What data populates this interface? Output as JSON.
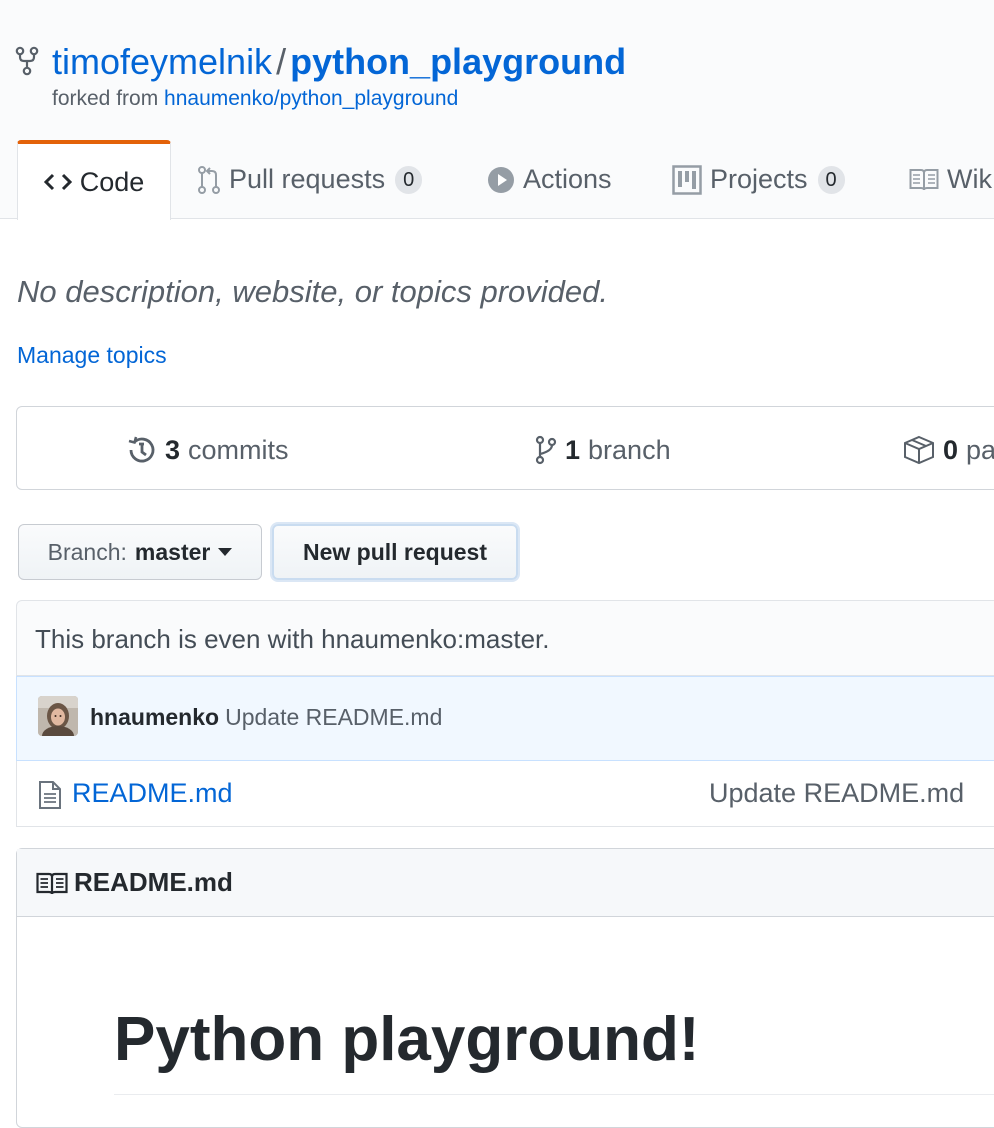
{
  "repo": {
    "owner": "timofeymelnik",
    "separator": "/",
    "name": "python_playground",
    "forked_prefix": "forked from",
    "forked_source": "hnaumenko/python_playground"
  },
  "tabs": [
    {
      "label": "Code",
      "icon": "code-icon",
      "selected": true
    },
    {
      "label": "Pull requests",
      "count": "0",
      "icon": "git-pull-request-icon"
    },
    {
      "label": "Actions",
      "icon": "play-icon"
    },
    {
      "label": "Projects",
      "count": "0",
      "icon": "project-icon"
    },
    {
      "label": "Wik",
      "icon": "book-icon"
    }
  ],
  "description": "No description, website, or topics provided.",
  "manage_topics": "Manage topics",
  "summary": {
    "commits": {
      "count": "3",
      "label": "commits"
    },
    "branches": {
      "count": "1",
      "label": "branch"
    },
    "packages": {
      "count": "0",
      "label": "pa"
    }
  },
  "toolbar": {
    "branch_label": "Branch:",
    "branch_value": "master",
    "new_pr_label": "New pull request"
  },
  "branch_status": "This branch is even with hnaumenko:master.",
  "latest_commit": {
    "author": "hnaumenko",
    "message": "Update README.md"
  },
  "files": [
    {
      "name": "README.md",
      "message": "Update README.md",
      "icon": "file-icon"
    }
  ],
  "readme": {
    "title": "README.md",
    "heading": "Python playground!"
  },
  "colors": {
    "link": "#0366d6",
    "tab_accent": "#e36209",
    "text": "#24292e",
    "muted": "#586069"
  }
}
